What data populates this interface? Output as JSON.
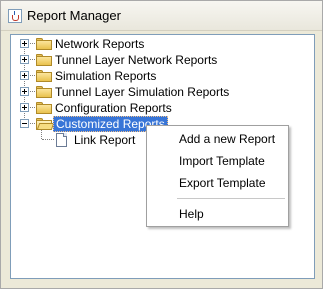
{
  "window": {
    "title": "Report Manager",
    "icon": "java-cup-icon"
  },
  "tree": {
    "items": [
      {
        "label": "Network Reports",
        "expanded": false
      },
      {
        "label": "Tunnel Layer Network Reports",
        "expanded": false
      },
      {
        "label": "Simulation Reports",
        "expanded": false
      },
      {
        "label": "Tunnel Layer Simulation Reports",
        "expanded": false
      },
      {
        "label": "Configuration Reports",
        "expanded": false
      },
      {
        "label": "Customized Reports",
        "expanded": true,
        "selected": true,
        "children": [
          {
            "label": "Link Report"
          }
        ]
      }
    ]
  },
  "context_menu": {
    "items": [
      {
        "label": "Add a new Report"
      },
      {
        "label": "Import Template"
      },
      {
        "label": "Export Template"
      },
      {
        "label": "Help"
      }
    ]
  },
  "colors": {
    "selection": "#3875d7",
    "window_bg": "#ece9d8",
    "panel_border": "#7f9db9"
  }
}
